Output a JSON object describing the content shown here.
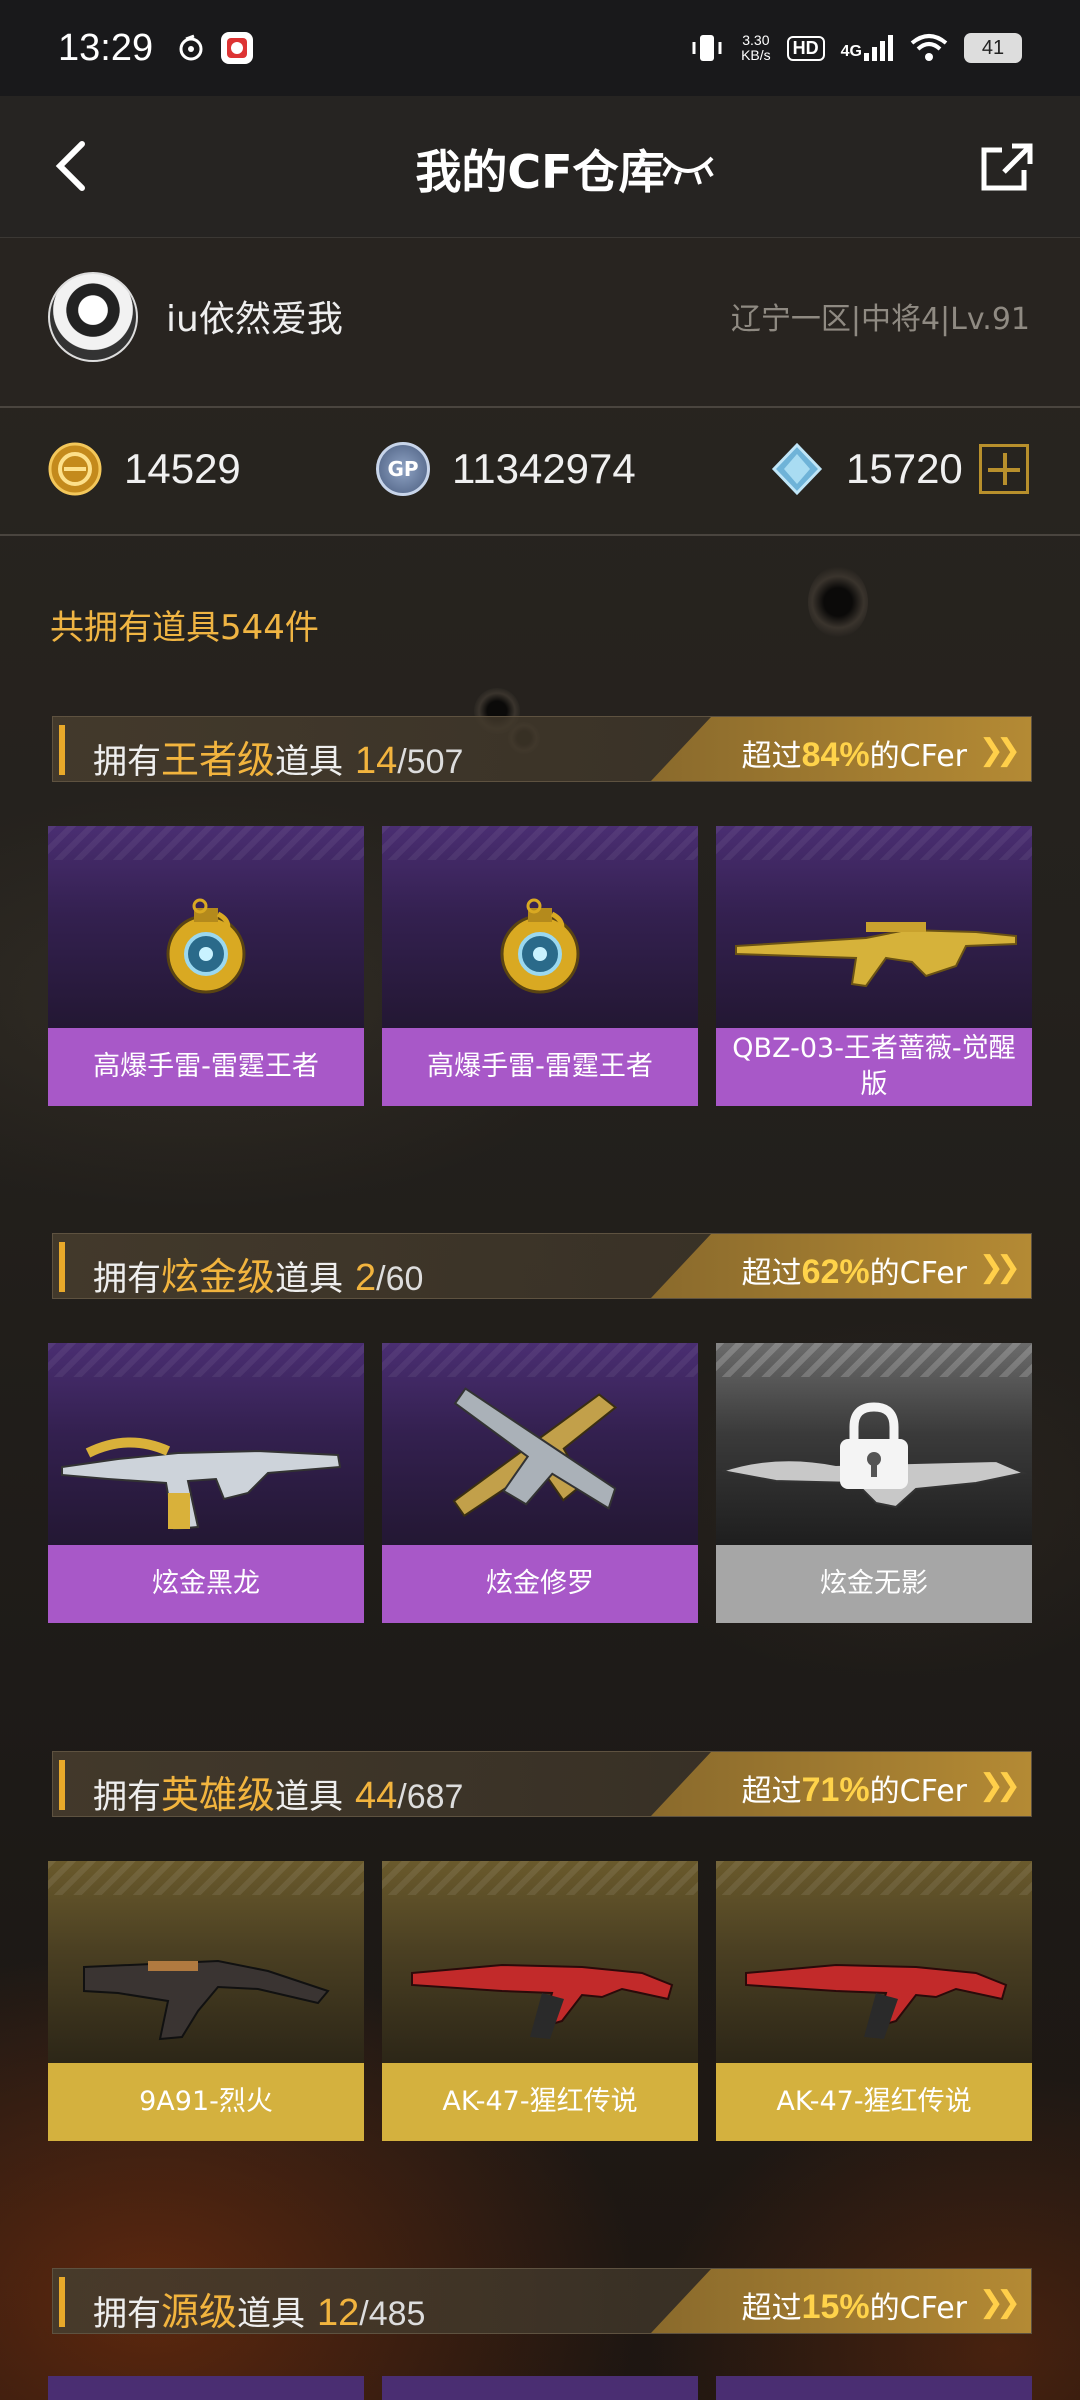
{
  "status_bar": {
    "time": "13:29",
    "net_speed_value": "3.30",
    "net_speed_unit": "KB/s",
    "hd": "HD",
    "network": "4G",
    "battery": "41"
  },
  "header": {
    "title": "我的CF仓库",
    "icons": [
      "back-arrow-icon",
      "eye-closed-icon",
      "share-icon"
    ]
  },
  "profile": {
    "username": "iu依然爱我",
    "server_info": "辽宁一区|中将4|Lv.91"
  },
  "currency": {
    "cf_points": "14529",
    "gp": "11342974",
    "gp_icon_text": "GP",
    "diamonds": "15720"
  },
  "total_items": "共拥有道具544件",
  "sections": [
    {
      "prefix": "拥有",
      "tier": "王者级",
      "suffix": "道具",
      "count": "14",
      "total": "/507",
      "rank_prefix": "超过",
      "rank_pct": "84%",
      "rank_suffix": "的CFer",
      "items": [
        "高爆手雷-雷霆王者",
        "高爆手雷-雷霆王者",
        "QBZ-03-王者蔷薇-觉醒版"
      ]
    },
    {
      "prefix": "拥有",
      "tier": "炫金级",
      "suffix": "道具",
      "count": "2",
      "total": "/60",
      "rank_prefix": "超过",
      "rank_pct": "62%",
      "rank_suffix": "的CFer",
      "items": [
        "炫金黑龙",
        "炫金修罗",
        "炫金无影"
      ]
    },
    {
      "prefix": "拥有",
      "tier": "英雄级",
      "suffix": "道具",
      "count": "44",
      "total": "/687",
      "rank_prefix": "超过",
      "rank_pct": "71%",
      "rank_suffix": "的CFer",
      "items": [
        "9A91-烈火",
        "AK-47-猩红传说",
        "AK-47-猩红传说"
      ]
    },
    {
      "prefix": "拥有",
      "tier": "源级",
      "suffix": "道具",
      "count": "12",
      "total": "/485",
      "rank_prefix": "超过",
      "rank_pct": "15%",
      "rank_suffix": "的CFer",
      "items": []
    }
  ],
  "colors": {
    "accent_gold": "#f2b43e",
    "purple_label": "#a858c8",
    "gold_label": "#d4b13e",
    "locked_label": "#a6a6a6"
  }
}
